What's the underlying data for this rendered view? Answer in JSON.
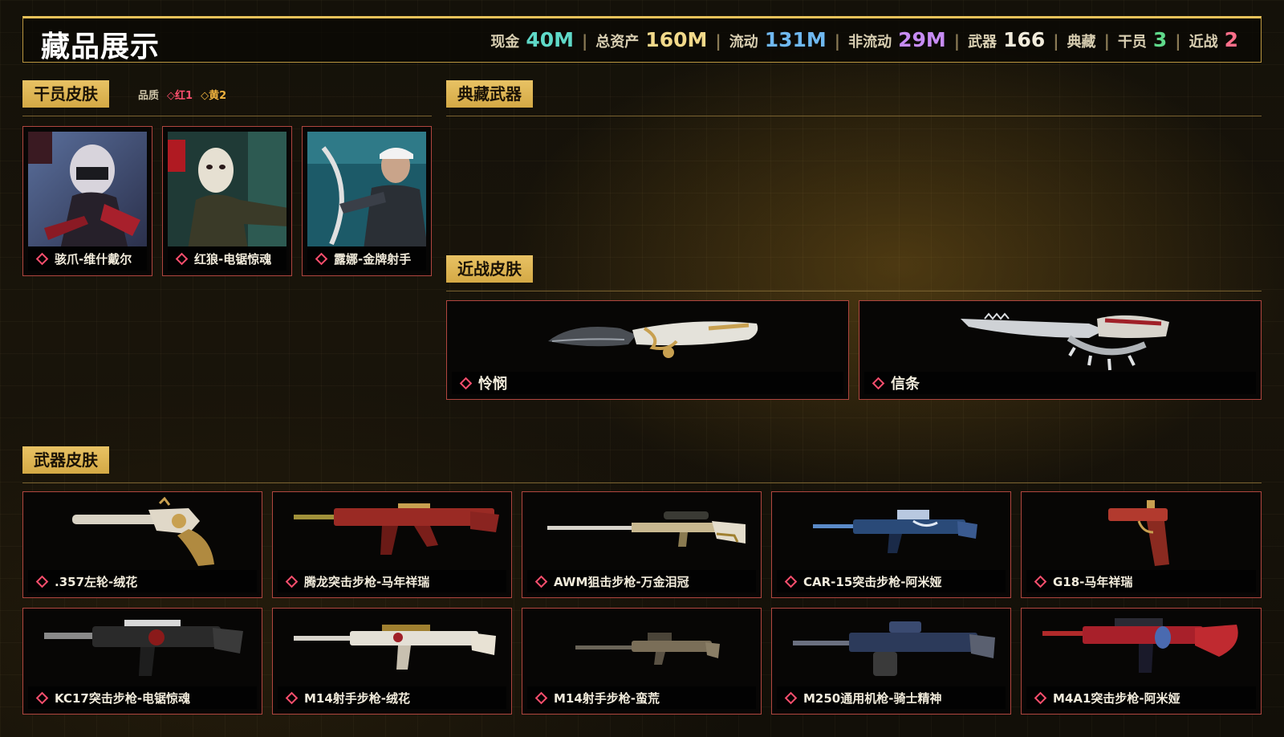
{
  "header": {
    "title": "藏品展示",
    "stats": [
      {
        "label": "现金",
        "value": "40M",
        "color": "#5fd9c8"
      },
      {
        "label": "总资产",
        "value": "160M",
        "color": "#f2d98a"
      },
      {
        "label": "流动",
        "value": "131M",
        "color": "#6fb8f0"
      },
      {
        "label": "非流动",
        "value": "29M",
        "color": "#c78cf5"
      },
      {
        "label": "武器",
        "value": "166",
        "color": "#f2ecdc"
      },
      {
        "label": "典藏",
        "value": "",
        "color": "#f2ecdc"
      },
      {
        "label": "干员",
        "value": "3",
        "color": "#5fd98a"
      },
      {
        "label": "近战",
        "value": "2",
        "color": "#ff6f8a"
      }
    ],
    "separator": "|"
  },
  "operator_section": {
    "title": "干员皮肤",
    "quality_label": "品质",
    "quality_red": "红1",
    "quality_yellow": "黄2",
    "cards": [
      {
        "name": "骇爪-维什戴尔",
        "icon": "operator-portrait-hackclaw"
      },
      {
        "name": "红狼-电锯惊魂",
        "icon": "operator-portrait-redwolf"
      },
      {
        "name": "露娜-金牌射手",
        "icon": "operator-portrait-luna"
      }
    ]
  },
  "collection_section": {
    "title": "典藏武器"
  },
  "melee_section": {
    "title": "近战皮肤",
    "cards": [
      {
        "name": "怜悯",
        "icon": "knife-karambit"
      },
      {
        "name": "信条",
        "icon": "knife-trench"
      }
    ]
  },
  "weapon_section": {
    "title": "武器皮肤",
    "cards": [
      {
        "name": ".357左轮-绒花",
        "icon": "revolver"
      },
      {
        "name": "腾龙突击步枪-马年祥瑞",
        "icon": "assault-rifle"
      },
      {
        "name": "AWM狙击步枪-万金泪冠",
        "icon": "sniper-rifle"
      },
      {
        "name": "CAR-15突击步枪-阿米娅",
        "icon": "assault-rifle"
      },
      {
        "name": "G18-马年祥瑞",
        "icon": "pistol"
      },
      {
        "name": "KC17突击步枪-电锯惊魂",
        "icon": "assault-rifle"
      },
      {
        "name": "M14射手步枪-绒花",
        "icon": "marksman-rifle"
      },
      {
        "name": "M14射手步枪-蛮荒",
        "icon": "marksman-rifle"
      },
      {
        "name": "M250通用机枪-骑士精神",
        "icon": "machine-gun"
      },
      {
        "name": "M4A1突击步枪-阿米娅",
        "icon": "assault-rifle"
      }
    ]
  }
}
